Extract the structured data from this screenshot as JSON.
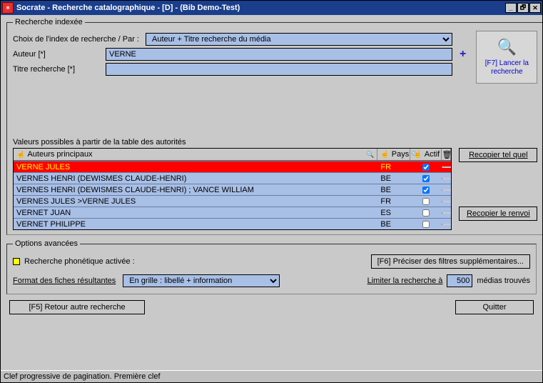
{
  "window": {
    "title": "Socrate - Recherche catalographique - [D] - (Bib Demo-Test)",
    "buttons": {
      "min": "_",
      "restore": "🗗",
      "close": "✕"
    }
  },
  "indexed": {
    "legend": "Recherche indexée",
    "indexLabel": "Choix de l'index de recherche  /  Par :",
    "indexValue": "Auteur + Titre recherche du média",
    "authorLabel": "Auteur [*]",
    "authorValue": "VERNE",
    "titleLabel": "Titre recherche [*]",
    "titleValue": "",
    "plus": "+",
    "searchBtn": "[F7] Lancer la recherche",
    "magnifier": "🔍"
  },
  "authorities": {
    "caption": "Valeurs possibles à partir de la table des autorités",
    "cols": {
      "author": "Auteurs principaux",
      "pays": "Pays",
      "actif": "Actif"
    },
    "rows": [
      {
        "author": "VERNE JULES",
        "pays": "FR",
        "actif": true,
        "sel": true
      },
      {
        "author": "VERNES HENRI (DEWISMES CLAUDE-HENRI)",
        "pays": "BE",
        "actif": true,
        "sel": false
      },
      {
        "author": "VERNES HENRI (DEWISMES CLAUDE-HENRI) ; VANCE WILLIAM",
        "pays": "BE",
        "actif": true,
        "sel": false
      },
      {
        "author": "VERNES JULES >VERNE JULES",
        "pays": "FR",
        "actif": false,
        "sel": false
      },
      {
        "author": "VERNET JUAN",
        "pays": "ES",
        "actif": false,
        "sel": false
      },
      {
        "author": "VERNET PHILIPPE",
        "pays": "BE",
        "actif": false,
        "sel": false
      }
    ],
    "copyAsIs": "Recopier tel quel",
    "copyRenvoi": "Recopier le renvoi"
  },
  "advanced": {
    "legend": "Options avancées",
    "phonetic": "Recherche phonétique activée :",
    "filtersBtn": "[F6] Préciser des filtres supplémentaires...",
    "formatLabel": "Format des fiches résultantes",
    "formatValue": "En grille : libellé + information",
    "limitLabel": "Limiter la recherche à",
    "limitValue": "500",
    "limitSuffix": "médias trouvés"
  },
  "footer": {
    "back": "[F5] Retour autre recherche",
    "quit": "Quitter"
  },
  "status": "Clef progressive de pagination. Première clef"
}
